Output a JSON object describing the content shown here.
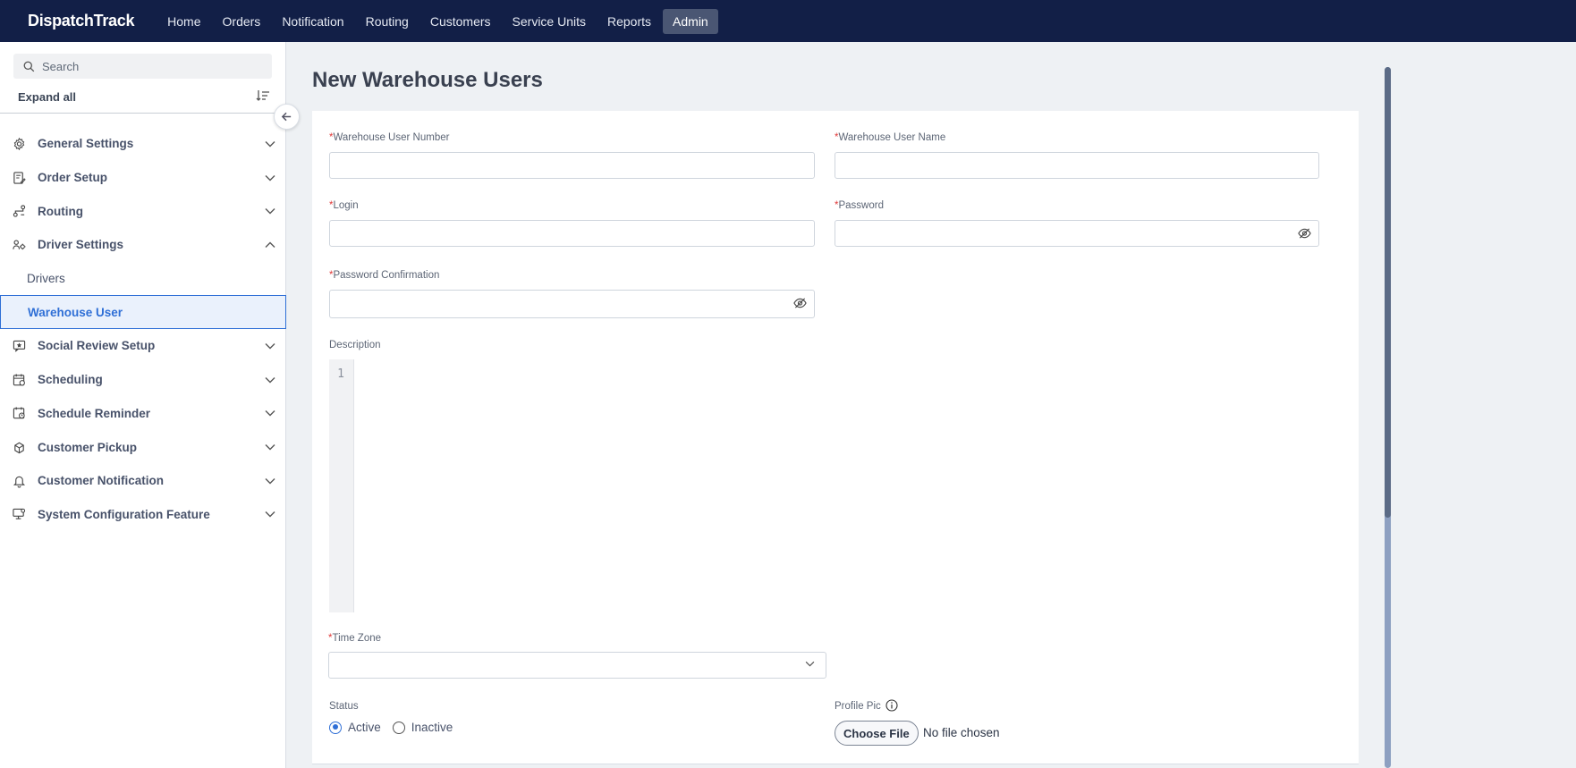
{
  "app": {
    "brand": "DispatchTrack",
    "nav": [
      "Home",
      "Orders",
      "Notification",
      "Routing",
      "Customers",
      "Service Units",
      "Reports",
      "Admin"
    ],
    "active_nav": "Admin"
  },
  "sidebar": {
    "search_placeholder": "Search",
    "expand_all": "Expand all",
    "items": [
      {
        "label": "General Settings",
        "icon": "gear-icon",
        "expanded": false
      },
      {
        "label": "Order Setup",
        "icon": "order-setup-icon",
        "expanded": false
      },
      {
        "label": "Routing",
        "icon": "routing-icon",
        "expanded": false
      },
      {
        "label": "Driver Settings",
        "icon": "driver-settings-icon",
        "expanded": true
      },
      {
        "label": "Social Review Setup",
        "icon": "review-icon",
        "expanded": false
      },
      {
        "label": "Scheduling",
        "icon": "calendar-icon",
        "expanded": false
      },
      {
        "label": "Schedule Reminder",
        "icon": "calendar-clock-icon",
        "expanded": false
      },
      {
        "label": "Customer Pickup",
        "icon": "pickup-icon",
        "expanded": false
      },
      {
        "label": "Customer Notification",
        "icon": "bell-icon",
        "expanded": false
      },
      {
        "label": "System Configuration Feature",
        "icon": "monitor-gear-icon",
        "expanded": false
      }
    ],
    "sub_items": [
      "Drivers",
      "Warehouse User"
    ],
    "selected_sub": "Warehouse User"
  },
  "page": {
    "title": "New Warehouse Users",
    "fields": {
      "warehouse_user_number": {
        "label": "Warehouse User Number",
        "required": "*",
        "value": ""
      },
      "warehouse_user_name": {
        "label": "Warehouse User Name",
        "required": "*",
        "value": ""
      },
      "login": {
        "label": "Login",
        "required": "*",
        "value": ""
      },
      "password": {
        "label": "Password",
        "required": "*",
        "value": ""
      },
      "password_confirmation": {
        "label": "Password Confirmation",
        "required": "*",
        "value": ""
      },
      "description": {
        "label": "Description",
        "line_number": "1"
      },
      "time_zone": {
        "label": "Time Zone",
        "required": "*",
        "value": ""
      },
      "status": {
        "label": "Status",
        "options": [
          "Active",
          "Inactive"
        ],
        "selected": "Active"
      },
      "profile_pic": {
        "label": "Profile Pic",
        "button": "Choose File",
        "file_status": "No file chosen"
      }
    }
  },
  "colors": {
    "topnav": "#121f47",
    "accent": "#2f6fd6",
    "required": "#e03b3b"
  }
}
